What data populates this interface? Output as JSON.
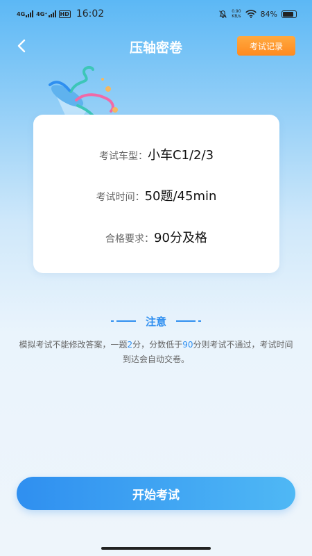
{
  "status_bar": {
    "sig1": "4G",
    "sig2": "4G⁺",
    "hd": "HD",
    "time": "16:02",
    "net_speed_value": "0.90",
    "net_speed_unit": "KB/s",
    "battery": "84%",
    "battery_level": 0.84
  },
  "nav": {
    "title": "压轴密卷",
    "record_button": "考试记录"
  },
  "card": {
    "rows": [
      {
        "label": "考试车型：",
        "value": "小车C1/2/3"
      },
      {
        "label": "考试时间：",
        "value": "50题/45min"
      },
      {
        "label": "合格要求：",
        "value": "90分及格"
      }
    ]
  },
  "notice": {
    "title": "注意",
    "text_parts": [
      "模拟考试不能修改答案，一题",
      "2",
      "分，分数低于",
      "90",
      "分则考试不通过，考试时间到达会自动交卷。"
    ]
  },
  "start_button": "开始考试",
  "colors": {
    "accent": "#2f8ff0",
    "orange": "#ff8a1f",
    "card_bg": "#ffffff"
  }
}
